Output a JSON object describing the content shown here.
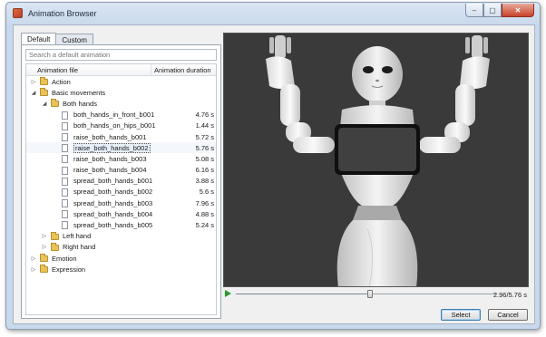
{
  "window": {
    "title": "Animation Browser",
    "close_glyph": "✕",
    "min_glyph": "–",
    "max_glyph": "▢"
  },
  "tabs": [
    {
      "label": "Default",
      "active": true
    },
    {
      "label": "Custom",
      "active": false
    }
  ],
  "search": {
    "placeholder": "Search a default animation",
    "value": ""
  },
  "tree": {
    "columns": {
      "name": "Animation file",
      "duration": "Animation duration"
    },
    "rows": [
      {
        "label": "Action",
        "kind": "folder",
        "depth": 0,
        "expanded": false,
        "duration": ""
      },
      {
        "label": "Basic movements",
        "kind": "folder",
        "depth": 0,
        "expanded": true,
        "duration": ""
      },
      {
        "label": "Both hands",
        "kind": "folder",
        "depth": 1,
        "expanded": true,
        "duration": ""
      },
      {
        "label": "both_hands_in_front_b001",
        "kind": "file",
        "depth": 2,
        "duration": "4.76 s"
      },
      {
        "label": "both_hands_on_hips_b001",
        "kind": "file",
        "depth": 2,
        "duration": "1.44 s"
      },
      {
        "label": "raise_both_hands_b001",
        "kind": "file",
        "depth": 2,
        "duration": "5.72 s"
      },
      {
        "label": "raise_both_hands_b002",
        "kind": "file",
        "depth": 2,
        "duration": "5.76 s",
        "selected": true
      },
      {
        "label": "raise_both_hands_b003",
        "kind": "file",
        "depth": 2,
        "duration": "5.08 s"
      },
      {
        "label": "raise_both_hands_b004",
        "kind": "file",
        "depth": 2,
        "duration": "6.16 s"
      },
      {
        "label": "spread_both_hands_b001",
        "kind": "file",
        "depth": 2,
        "duration": "3.88 s"
      },
      {
        "label": "spread_both_hands_b002",
        "kind": "file",
        "depth": 2,
        "duration": "5.6 s"
      },
      {
        "label": "spread_both_hands_b003",
        "kind": "file",
        "depth": 2,
        "duration": "7.96 s"
      },
      {
        "label": "spread_both_hands_b004",
        "kind": "file",
        "depth": 2,
        "duration": "4.88 s"
      },
      {
        "label": "spread_both_hands_b005",
        "kind": "file",
        "depth": 2,
        "duration": "5.24 s"
      },
      {
        "label": "Left hand",
        "kind": "folder",
        "depth": 1,
        "expanded": false,
        "duration": ""
      },
      {
        "label": "Right hand",
        "kind": "folder",
        "depth": 1,
        "expanded": false,
        "duration": ""
      },
      {
        "label": "Emotion",
        "kind": "folder",
        "depth": 0,
        "expanded": false,
        "duration": ""
      },
      {
        "label": "Expression",
        "kind": "folder",
        "depth": 0,
        "expanded": false,
        "duration": ""
      }
    ]
  },
  "player": {
    "time_readout": "2.96/5.76 s",
    "progress": 0.514
  },
  "buttons": {
    "select": "Select",
    "cancel": "Cancel"
  },
  "colors": {
    "preview_bg": "#3a3a3a",
    "play": "#2a9a2a",
    "folder": "#e8c25a"
  }
}
